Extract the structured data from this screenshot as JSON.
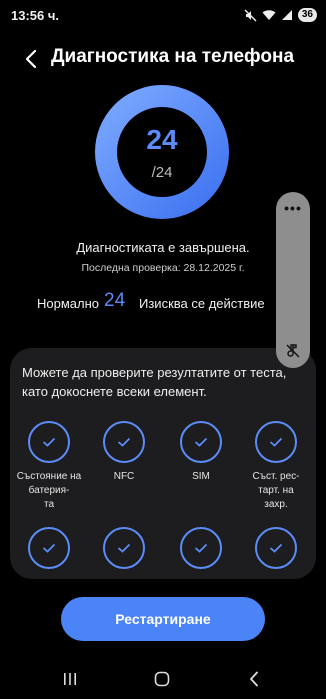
{
  "status_bar": {
    "time": "13:56 ч.",
    "battery": "36",
    "icons": [
      "mute-icon",
      "wifi-icon",
      "signal-icon",
      "battery-icon"
    ]
  },
  "header": {
    "title": "Диагностика на телефона",
    "back_icon": "back-arrow-icon"
  },
  "score": {
    "passed": "24",
    "total": "/24"
  },
  "status": {
    "done": "Диагностиката е завършена.",
    "last_check": "Последна проверка: 28.12.2025 г.",
    "normal_label": "Нормално",
    "normal_count": "24",
    "action_label": "Изисква се действие"
  },
  "side_panel": {
    "menu_icon": "more-dots-icon",
    "sound_icon": "sound-off-icon"
  },
  "results": {
    "instructions": "Можете да проверите резултатите от теста, като докоснете всеки елемент.",
    "items": [
      {
        "label": "Състояние на батерия-\nта",
        "status": "passed"
      },
      {
        "label": "NFC",
        "status": "passed"
      },
      {
        "label": "SIM",
        "status": "passed"
      },
      {
        "label": "Съст. рес-\nтарт. на\nзахр.",
        "status": "passed"
      },
      {
        "label": "",
        "status": "passed"
      },
      {
        "label": "",
        "status": "passed"
      },
      {
        "label": "",
        "status": "passed"
      },
      {
        "label": "",
        "status": "passed"
      }
    ]
  },
  "actions": {
    "restart_label": "Рестартиране"
  },
  "nav_bar": {
    "icons": [
      "recent-apps-icon",
      "home-icon",
      "back-icon"
    ]
  },
  "colors": {
    "accent": "#4b84f6",
    "ring_start": "#3f73f1",
    "ring_end": "#7aa8ff",
    "card_bg": "#1d1d1f",
    "panel_bg": "#8e8e8e"
  }
}
